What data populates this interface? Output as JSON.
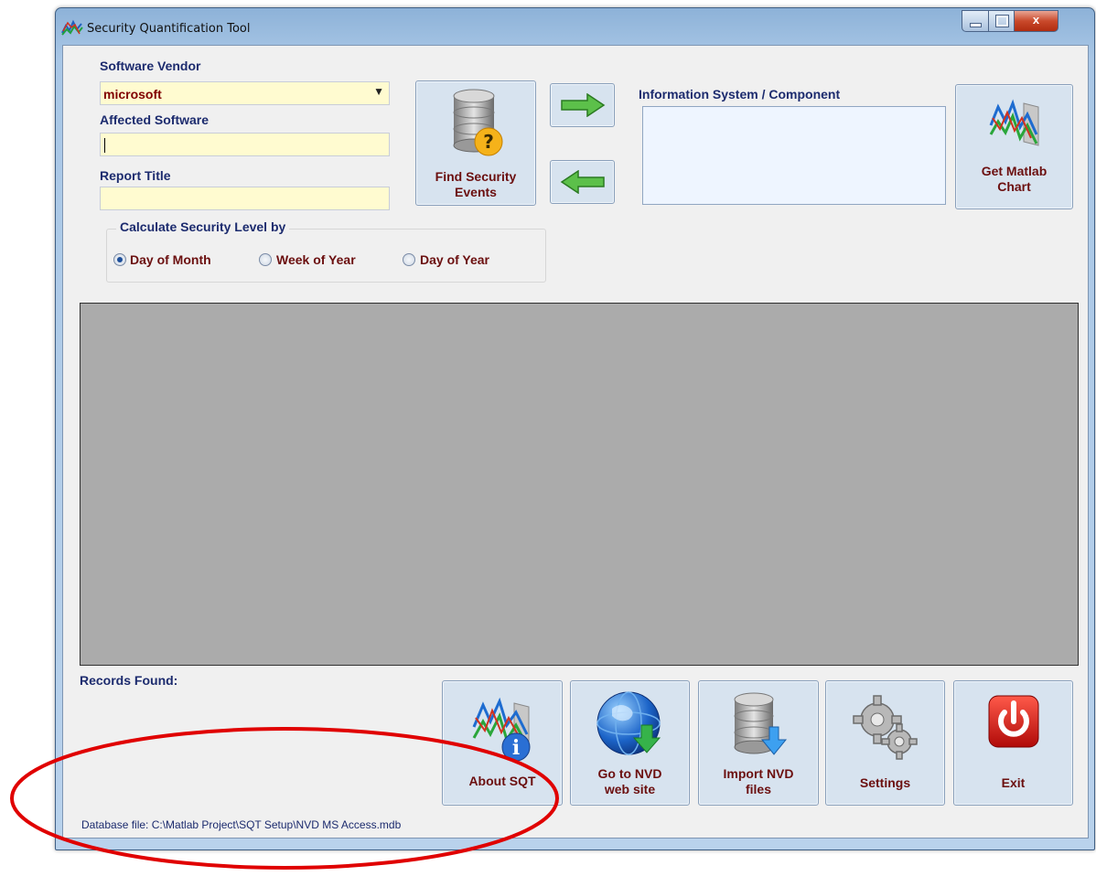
{
  "window": {
    "title": "Security Quantification Tool",
    "controls": {
      "minimize": "minimize",
      "maximize": "maximize",
      "close": "x"
    }
  },
  "form": {
    "vendor_label": "Software Vendor",
    "vendor_value": "microsoft",
    "affected_label": "Affected Software",
    "affected_value": "",
    "report_label": "Report Title",
    "report_value": "",
    "info_label": "Information System / Component"
  },
  "buttons": {
    "find": {
      "line1": "Find Security",
      "line2": "Events",
      "icon": "database-question-icon"
    },
    "arrow_right": {
      "icon": "arrow-right-icon"
    },
    "arrow_left": {
      "icon": "arrow-left-icon"
    },
    "matlab": {
      "line1": "Get Matlab",
      "line2": "Chart",
      "icon": "chart-icon"
    },
    "about": {
      "line1": "About SQT",
      "icon": "chart-info-icon"
    },
    "nvd_site": {
      "line1": "Go to NVD",
      "line2": "web site",
      "icon": "globe-download-icon"
    },
    "import": {
      "line1": "Import NVD",
      "line2": "files",
      "icon": "database-import-icon"
    },
    "settings": {
      "line1": "Settings",
      "icon": "gears-icon"
    },
    "exit": {
      "line1": "Exit",
      "icon": "power-icon"
    }
  },
  "calc": {
    "group_title": "Calculate Security Level by",
    "options": [
      "Day of Month",
      "Week of Year",
      "Day of Year"
    ],
    "selected": "Day of Month"
  },
  "records_label": "Records Found:",
  "status": "Database file: C:\\Matlab Project\\SQT Setup\\NVD MS Access.mdb",
  "colors": {
    "label_blue": "#1c2b6e",
    "label_red": "#6b0f0f",
    "field_yellow": "#fffbd0",
    "annotation_red": "#e00000"
  }
}
